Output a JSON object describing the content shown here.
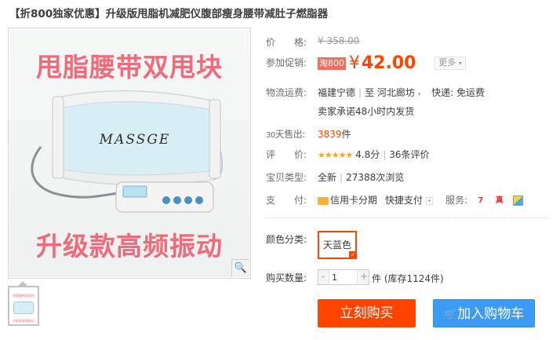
{
  "title": "【折800独家优惠】升级版甩脂机减肥仪腹部瘦身腰带减肚子燃脂器",
  "image": {
    "promo_top": "甩脂腰带双甩块",
    "promo_bottom": "升级款高频振动",
    "brand_text": "MASSGE",
    "thumb_top": "甩脂腰带双甩块",
    "thumb_bottom": "升级款高频振动"
  },
  "price": {
    "label": "价　　格:",
    "original": "¥ 358.00"
  },
  "promo": {
    "label": "参加促销:",
    "badge": "淘800",
    "currency": "¥",
    "price": "42.00",
    "more": "更多"
  },
  "shipping": {
    "label": "物流运费:",
    "from": "福建宁德",
    "sep": "|",
    "to_prefix": "至",
    "to": "河北廊坊",
    "express": "快递: 免运费",
    "promise": "卖家承诺48小时内发货"
  },
  "sales": {
    "label_num": "30",
    "label": "天售出:",
    "count": "3839",
    "unit": "件"
  },
  "rating": {
    "label": "评　　价:",
    "stars": "★★★★★",
    "score": "4.8分",
    "sep": "|",
    "reviews": "36条评价"
  },
  "item_type": {
    "label": "宝贝类型:",
    "condition": "全新",
    "sep": "|",
    "views": "27388次浏览"
  },
  "payment": {
    "label": "支　　付:",
    "credit": "信用卡分期",
    "fast": "快捷支付",
    "service_label": "服务:"
  },
  "color": {
    "label": "颜色分类:",
    "option": "天蓝色"
  },
  "quantity": {
    "label": "购买数量:",
    "value": "1",
    "unit": "件 (库存1124件)"
  },
  "buttons": {
    "buy": "立刻购买",
    "cart": "加入购物车"
  },
  "colors": {
    "accent": "#ff4400",
    "cart_blue": "#3c9cf5",
    "promo_pink": "#f06a7a"
  }
}
